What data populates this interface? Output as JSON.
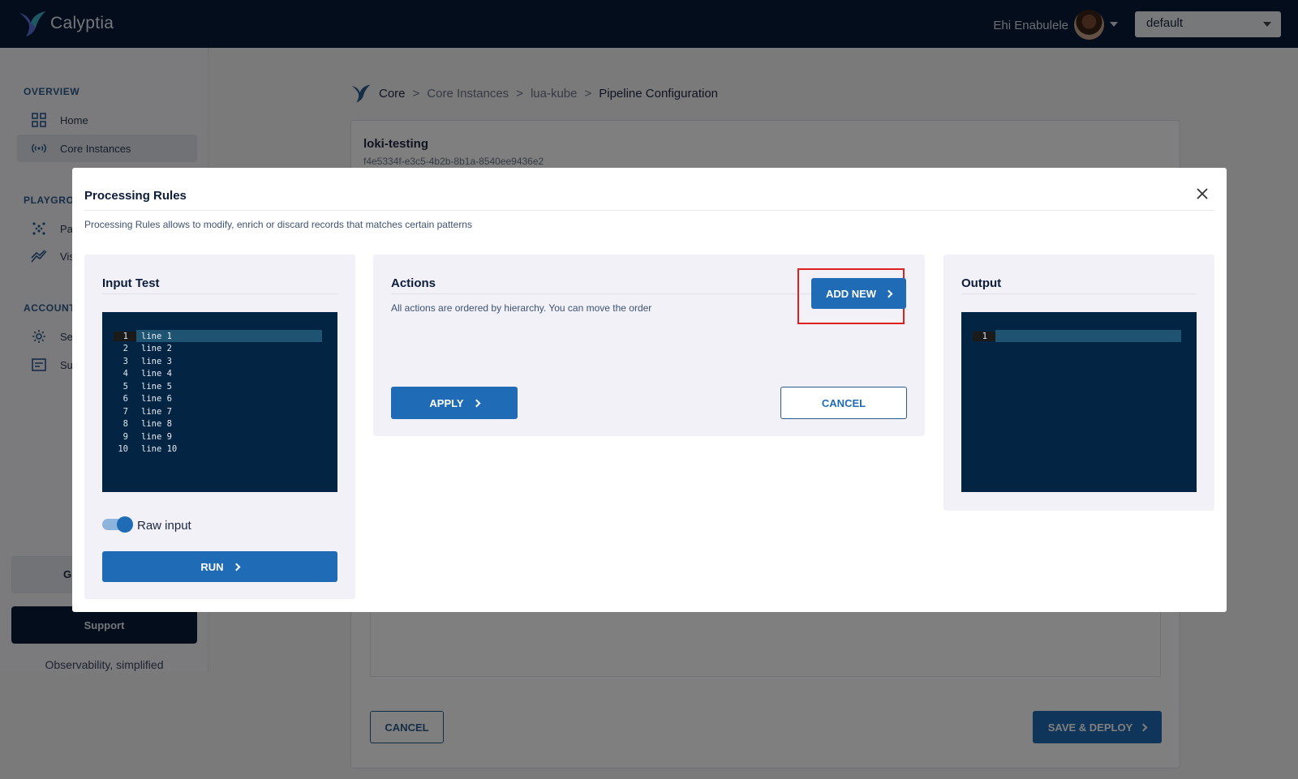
{
  "app": {
    "name": "Calyptia"
  },
  "topbar": {
    "user_name": "Ehi Enabulele",
    "namespace": "default"
  },
  "sidebar": {
    "sections": [
      {
        "label": "OVERVIEW"
      },
      {
        "label": "PLAYGRO"
      },
      {
        "label": "ACCOUNT"
      }
    ],
    "items": [
      {
        "label": "Home",
        "icon": "grid-icon"
      },
      {
        "label": "Core Instances",
        "icon": "broadcast-icon"
      },
      {
        "label": "Pa",
        "icon": "dots-icon"
      },
      {
        "label": "Vis",
        "icon": "chart-line-icon"
      },
      {
        "label": "Se",
        "icon": "gear-icon"
      },
      {
        "label": "Su",
        "icon": "document-icon"
      }
    ],
    "g_button_label": "G",
    "support_label": "Support",
    "tagline": "Observability, simplified"
  },
  "breadcrumb": [
    "Core",
    "Core Instances",
    "lua-kube",
    "Pipeline Configuration"
  ],
  "main": {
    "title": "loki-testing",
    "id": "f4e5334f-e3c5-4b2b-8b1a-8540ee9436e2",
    "cancel_label": "CANCEL",
    "deploy_label": "SAVE & DEPLOY"
  },
  "modal": {
    "title": "Processing Rules",
    "description": "Processing Rules allows to modify, enrich or discard records that matches certain patterns",
    "input_panel": {
      "title": "Input Test",
      "lines": [
        {
          "num": "1",
          "text": "line 1"
        },
        {
          "num": "2",
          "text": "line 2"
        },
        {
          "num": "3",
          "text": "line 3"
        },
        {
          "num": "4",
          "text": "line 4"
        },
        {
          "num": "5",
          "text": "line 5"
        },
        {
          "num": "6",
          "text": "line 6"
        },
        {
          "num": "7",
          "text": "line 7"
        },
        {
          "num": "8",
          "text": "line 8"
        },
        {
          "num": "9",
          "text": "line 9"
        },
        {
          "num": "10",
          "text": "line 10"
        }
      ],
      "toggle_label": "Raw input",
      "toggle_on": true,
      "run_label": "RUN"
    },
    "actions_panel": {
      "title": "Actions",
      "description": "All actions are ordered by hierarchy. You can move the order",
      "add_new_label": "ADD NEW",
      "apply_label": "APPLY",
      "cancel_label": "CANCEL"
    },
    "output_panel": {
      "title": "Output",
      "lines": [
        {
          "num": "1",
          "text": ""
        }
      ]
    }
  },
  "colors": {
    "primary": "#1f6bb5",
    "navy": "#071a36",
    "code_bg": "#032443",
    "highlight": "#e02020"
  }
}
